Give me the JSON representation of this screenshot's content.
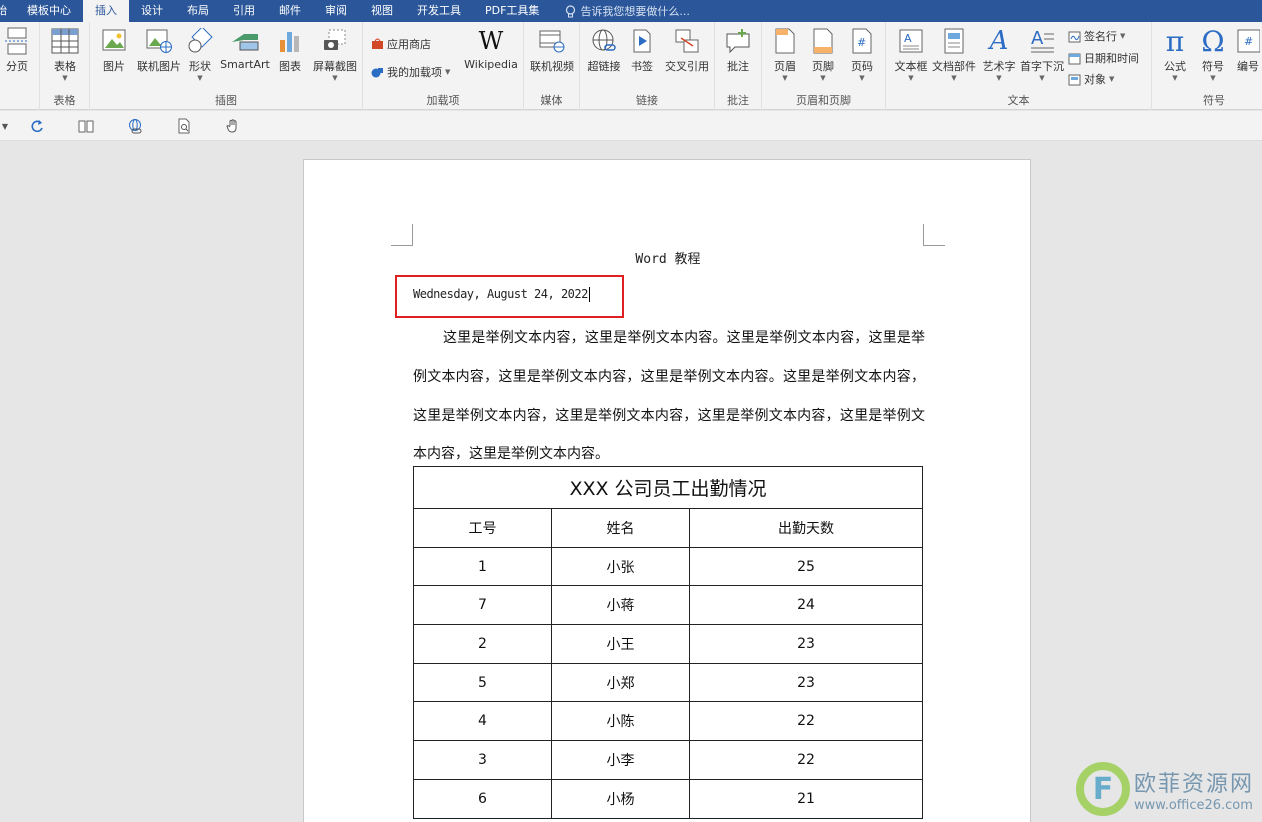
{
  "tabs": [
    "始",
    "模板中心",
    "插入",
    "设计",
    "布局",
    "引用",
    "邮件",
    "审阅",
    "视图",
    "开发工具",
    "PDF工具集"
  ],
  "active_tab": "插入",
  "tell_me": "告诉我您想要做什么...",
  "ribbon": {
    "page_break": "分页",
    "table": "表格",
    "group_table": "表格",
    "picture": "图片",
    "online_picture": "联机图片",
    "shapes": "形状",
    "smartart": "SmartArt",
    "chart": "图表",
    "screenshot": "屏幕截图",
    "group_illustrations": "插图",
    "store": "应用商店",
    "my_addins": "我的加载项",
    "wikipedia": "Wikipedia",
    "group_addins": "加载项",
    "online_video": "联机视频",
    "group_media": "媒体",
    "hyperlink": "超链接",
    "bookmark": "书签",
    "cross_ref": "交叉引用",
    "group_links": "链接",
    "comment": "批注",
    "group_comments": "批注",
    "header": "页眉",
    "footer": "页脚",
    "page_number": "页码",
    "group_header_footer": "页眉和页脚",
    "textbox": "文本框",
    "quick_parts": "文档部件",
    "wordart": "艺术字",
    "drop_cap": "首字下沉",
    "signature": "签名行",
    "date_time": "日期和时间",
    "object": "对象",
    "group_text": "文本",
    "equation": "公式",
    "symbol": "符号",
    "numbering": "编号",
    "group_symbols": "符号"
  },
  "document": {
    "header": "Word 教程",
    "date": "Wednesday, August 24, 2022",
    "paragraph": "这里是举例文本内容，这里是举例文本内容。这里是举例文本内容，这里是举例文本内容，这里是举例文本内容，这里是举例文本内容。这里是举例文本内容，这里是举例文本内容，这里是举例文本内容，这里是举例文本内容，这里是举例文本内容，这里是举例文本内容。",
    "table": {
      "title": "XXX 公司员工出勤情况",
      "headers": [
        "工号",
        "姓名",
        "出勤天数"
      ],
      "rows": [
        [
          "1",
          "小张",
          "25"
        ],
        [
          "7",
          "小蒋",
          "24"
        ],
        [
          "2",
          "小王",
          "23"
        ],
        [
          "5",
          "小郑",
          "23"
        ],
        [
          "4",
          "小陈",
          "22"
        ],
        [
          "3",
          "小李",
          "22"
        ],
        [
          "6",
          "小杨",
          "21"
        ]
      ]
    }
  },
  "watermark": {
    "logo_letter": "F",
    "name": "欧菲资源网",
    "url": "www.office26.com"
  }
}
